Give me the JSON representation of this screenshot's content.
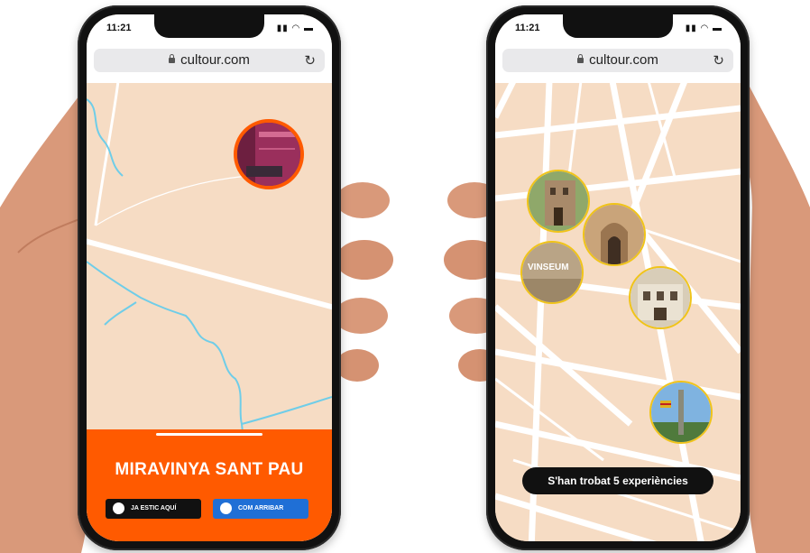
{
  "left_phone": {
    "time": "11:21",
    "url": "cultour.com",
    "place_title": "MIRAVINYA SANT PAU",
    "pin_photo": {
      "alt": "Miravinya"
    },
    "buttons": [
      {
        "label": "JA ESTIC AQUÍ",
        "color": "#111111"
      },
      {
        "label": "COM ARRIBAR",
        "color": "#1f6fd6"
      }
    ]
  },
  "right_phone": {
    "time": "11:21",
    "url": "cultour.com",
    "pin_labels": [
      "VINSEUM"
    ],
    "toast": "S'han trobat 5 experiències"
  },
  "colors": {
    "map_bg": "#f6dcc4",
    "road": "#ffffff",
    "river": "#6fcde8",
    "accent": "#ff5a00",
    "pin_border_active": "#ff5a00",
    "pin_border": "#f0c419"
  }
}
